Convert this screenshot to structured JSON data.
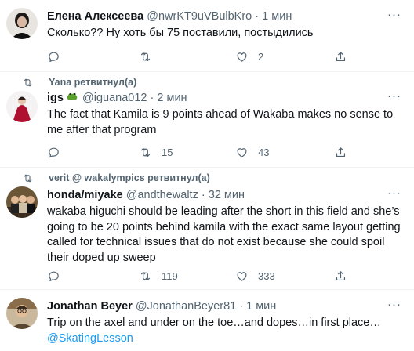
{
  "tweets": [
    {
      "name": "Елена Алексеева",
      "handle": "@nwrKT9uVBulbKro",
      "dot": "·",
      "time": "1 мин",
      "text": "Сколько?? Ну хоть бы 75 поставили, постыдились",
      "counts": {
        "reply": "",
        "retweet": "",
        "like": "2"
      }
    },
    {
      "retweeted_by": "Yana ретвитнул(а)",
      "name": "igs",
      "handle": "@iguana012",
      "dot": "·",
      "time": "2 мин",
      "text": "The fact that Kamila is 9 points ahead of Wakaba makes no sense to me after that program",
      "counts": {
        "reply": "",
        "retweet": "15",
        "like": "43"
      }
    },
    {
      "retweeted_by": "verit @ wakalympics ретвитнул(а)",
      "name": "honda/miyake",
      "handle": "@andthewaltz",
      "dot": "·",
      "time": "32 мин",
      "text": "wakaba higuchi should be leading after the short in this field and she’s going to be 20 points behind kamila with the exact same layout getting called for technical issues that do not exist because she could spoil their doped up sweep",
      "counts": {
        "reply": "",
        "retweet": "119",
        "like": "333"
      }
    },
    {
      "name": "Jonathan Beyer",
      "handle": "@JonathanBeyer81",
      "dot": "·",
      "time": "1 мин",
      "text": "Trip on the axel and under on the toe…and dopes…in first place…",
      "mention": "@SkatingLesson"
    }
  ],
  "more_label": "···",
  "colors": {
    "accent": "#1d9bf0",
    "muted": "#536471",
    "text": "#0f1419",
    "border": "#eff3f4"
  },
  "icons": [
    "reply-icon",
    "retweet-icon",
    "like-icon",
    "share-icon",
    "more-icon",
    "frog-emoji-icon"
  ]
}
